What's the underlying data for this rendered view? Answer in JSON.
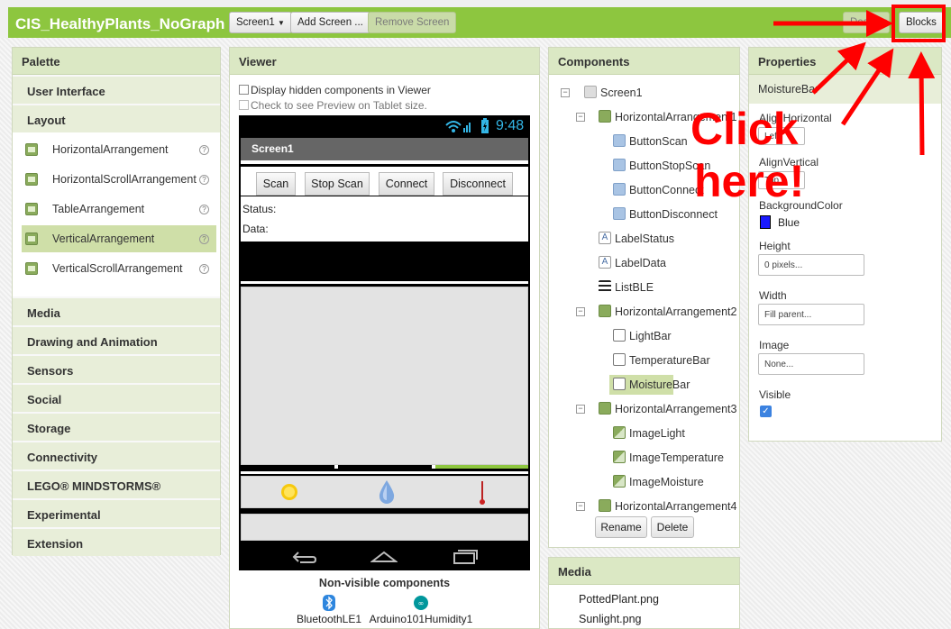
{
  "header": {
    "app_title": "CIS_HealthyPlants_NoGraph",
    "screen_select": "Screen1",
    "add_screen": "Add Screen ...",
    "remove_screen": "Remove Screen",
    "designer": "Designer",
    "blocks": "Blocks"
  },
  "palette": {
    "title": "Palette",
    "categories_top": [
      "User Interface",
      "Layout"
    ],
    "layout_items": [
      "HorizontalArrangement",
      "HorizontalScrollArrangement",
      "TableArrangement",
      "VerticalArrangement",
      "VerticalScrollArrangement"
    ],
    "selected_item": "VerticalArrangement",
    "categories_bottom": [
      "Media",
      "Drawing and Animation",
      "Sensors",
      "Social",
      "Storage",
      "Connectivity",
      "LEGO® MINDSTORMS®",
      "Experimental",
      "Extension"
    ]
  },
  "viewer": {
    "title": "Viewer",
    "display_hidden": "Display hidden components in Viewer",
    "tablet_preview": "Check to see Preview on Tablet size.",
    "clock": "9:48",
    "screen_title": "Screen1",
    "buttons": [
      "Scan",
      "Stop Scan",
      "Connect",
      "Disconnect"
    ],
    "status_label": "Status:",
    "data_label": "Data:",
    "non_visible_title": "Non-visible components",
    "non_visible": [
      "BluetoothLE1",
      "Arduino101Humidity1"
    ]
  },
  "components": {
    "title": "Components",
    "tree": [
      {
        "label": "Screen1",
        "icon": "screen"
      },
      {
        "label": "HorizontalArrangement1",
        "icon": "arrangement"
      },
      {
        "label": "ButtonScan",
        "icon": "button"
      },
      {
        "label": "ButtonStopScan",
        "icon": "button"
      },
      {
        "label": "ButtonConnect",
        "icon": "button"
      },
      {
        "label": "ButtonDisconnect",
        "icon": "button"
      },
      {
        "label": "LabelStatus",
        "icon": "label"
      },
      {
        "label": "LabelData",
        "icon": "label"
      },
      {
        "label": "ListBLE",
        "icon": "list"
      },
      {
        "label": "HorizontalArrangement2",
        "icon": "arrangement"
      },
      {
        "label": "LightBar",
        "icon": "bar"
      },
      {
        "label": "TemperatureBar",
        "icon": "bar"
      },
      {
        "label": "MoistureBar",
        "icon": "bar"
      },
      {
        "label": "HorizontalArrangement3",
        "icon": "arrangement"
      },
      {
        "label": "ImageLight",
        "icon": "image"
      },
      {
        "label": "ImageTemperature",
        "icon": "image"
      },
      {
        "label": "ImageMoisture",
        "icon": "image"
      },
      {
        "label": "HorizontalArrangement4",
        "icon": "arrangement"
      }
    ],
    "selected": "MoistureBar",
    "rename": "Rename",
    "delete": "Delete"
  },
  "media": {
    "title": "Media",
    "files": [
      "PottedPlant.png",
      "Sunlight.png"
    ]
  },
  "properties": {
    "title": "Properties",
    "component": "MoistureBar",
    "align_horizontal": "AlignHorizontal",
    "align_horizontal_value": "Left",
    "align_vertical": "AlignVertical",
    "align_vertical_value": "Top",
    "background_color": "BackgroundColor",
    "background_color_value": "Blue",
    "background_swatch": "#1a1aff",
    "height": "Height",
    "height_value": "0 pixels...",
    "width": "Width",
    "width_value": "Fill parent...",
    "image": "Image",
    "image_value": "None...",
    "visible": "Visible",
    "visible_checked": true
  },
  "annotation": {
    "line1": "Click",
    "line2": "here!",
    "color": "#ff0000"
  },
  "colors": {
    "accent": "#8dc63f",
    "panel_header": "#dbe8c4"
  }
}
